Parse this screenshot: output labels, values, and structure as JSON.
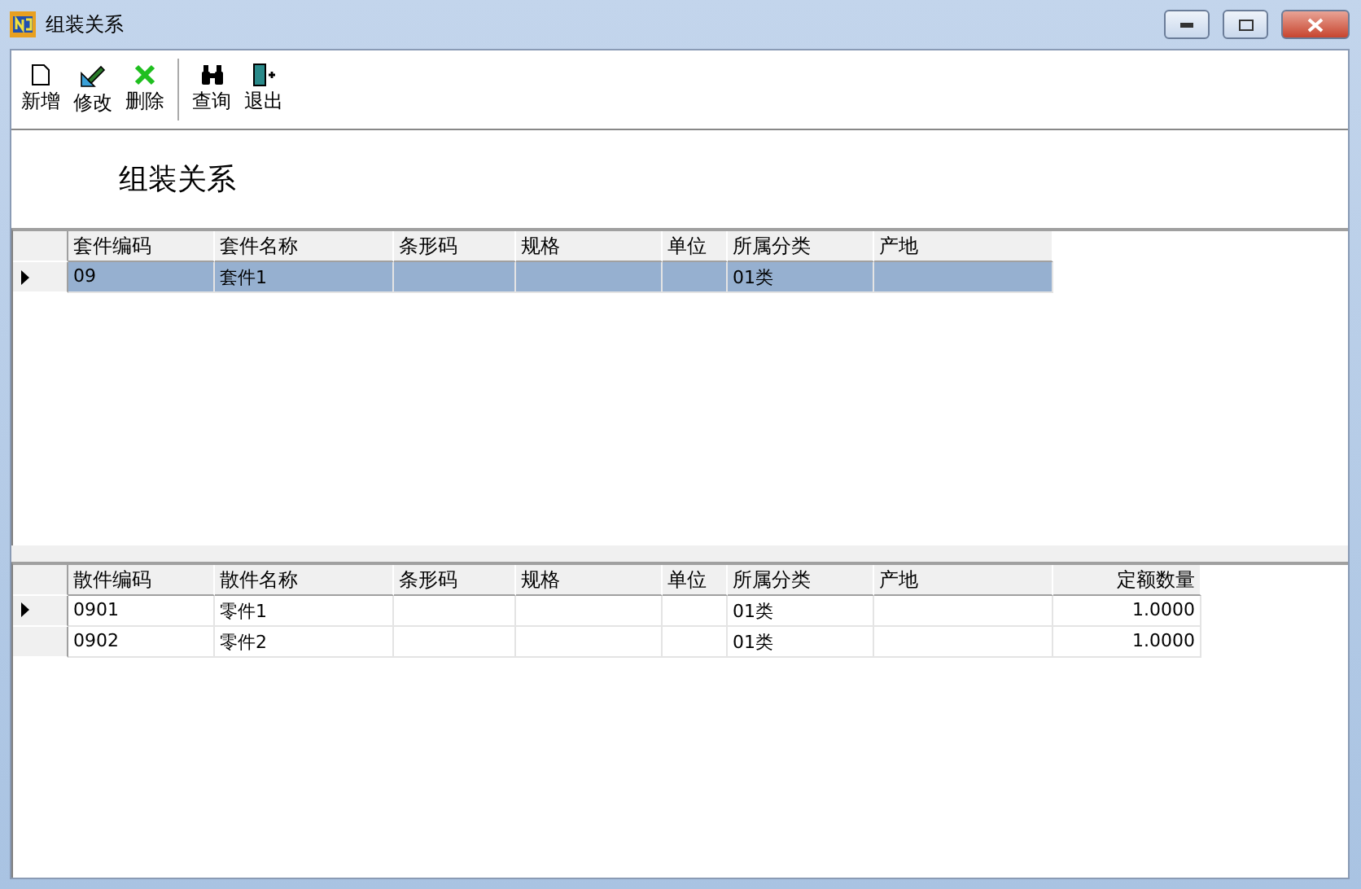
{
  "window": {
    "title": "组装关系"
  },
  "toolbar": [
    {
      "label": "新增"
    },
    {
      "label": "修改"
    },
    {
      "label": "删除"
    },
    {
      "label": "查询"
    },
    {
      "label": "退出"
    }
  ],
  "heading": "组装关系",
  "kit_table": {
    "columns": [
      {
        "label": "套件编码"
      },
      {
        "label": "套件名称"
      },
      {
        "label": "条形码"
      },
      {
        "label": "规格"
      },
      {
        "label": "单位"
      },
      {
        "label": "所属分类"
      },
      {
        "label": "产地"
      }
    ],
    "rows": [
      {
        "current": true,
        "selected": true,
        "cells": [
          "09",
          "套件1",
          "",
          "",
          "",
          "01类",
          ""
        ]
      }
    ]
  },
  "part_table": {
    "columns": [
      {
        "label": "散件编码"
      },
      {
        "label": "散件名称"
      },
      {
        "label": "条形码"
      },
      {
        "label": "规格"
      },
      {
        "label": "单位"
      },
      {
        "label": "所属分类"
      },
      {
        "label": "产地"
      },
      {
        "label": "定额数量",
        "numeric": true
      }
    ],
    "rows": [
      {
        "current": true,
        "selected": false,
        "cells": [
          "0901",
          "零件1",
          "",
          "",
          "",
          "01类",
          "",
          "1.0000"
        ]
      },
      {
        "current": false,
        "selected": false,
        "cells": [
          "0902",
          "零件2",
          "",
          "",
          "",
          "01类",
          "",
          "1.0000"
        ]
      }
    ]
  }
}
